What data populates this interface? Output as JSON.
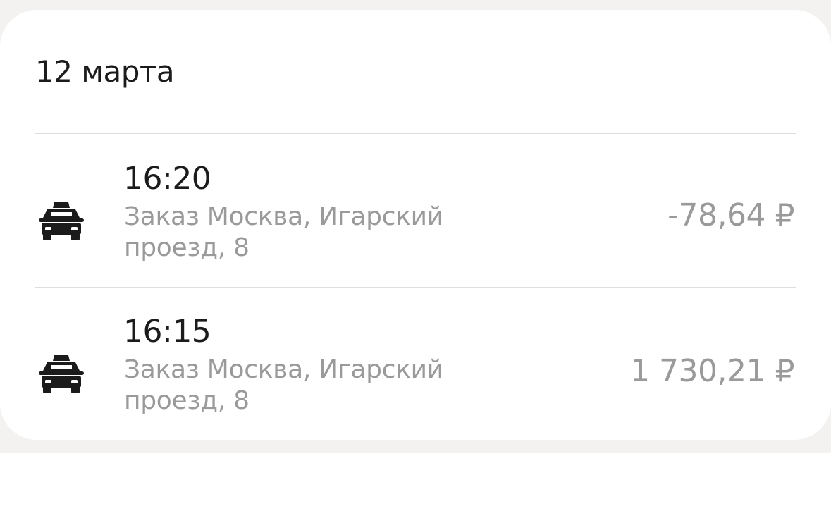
{
  "section": {
    "date_label": "12 марта"
  },
  "transactions": [
    {
      "icon": "taxi-icon",
      "time": "16:20",
      "description": "Заказ Москва, Игарский проезд, 8",
      "amount": "-78,64 ₽"
    },
    {
      "icon": "taxi-icon",
      "time": "16:15",
      "description": "Заказ Москва, Игарский проезд, 8",
      "amount": "1 730,21 ₽"
    }
  ],
  "colors": {
    "page_background": "#f3f2f0",
    "card_background": "#ffffff",
    "primary_text": "#1b1b1b",
    "secondary_text": "#9a9a9a",
    "divider": "#dedede"
  }
}
